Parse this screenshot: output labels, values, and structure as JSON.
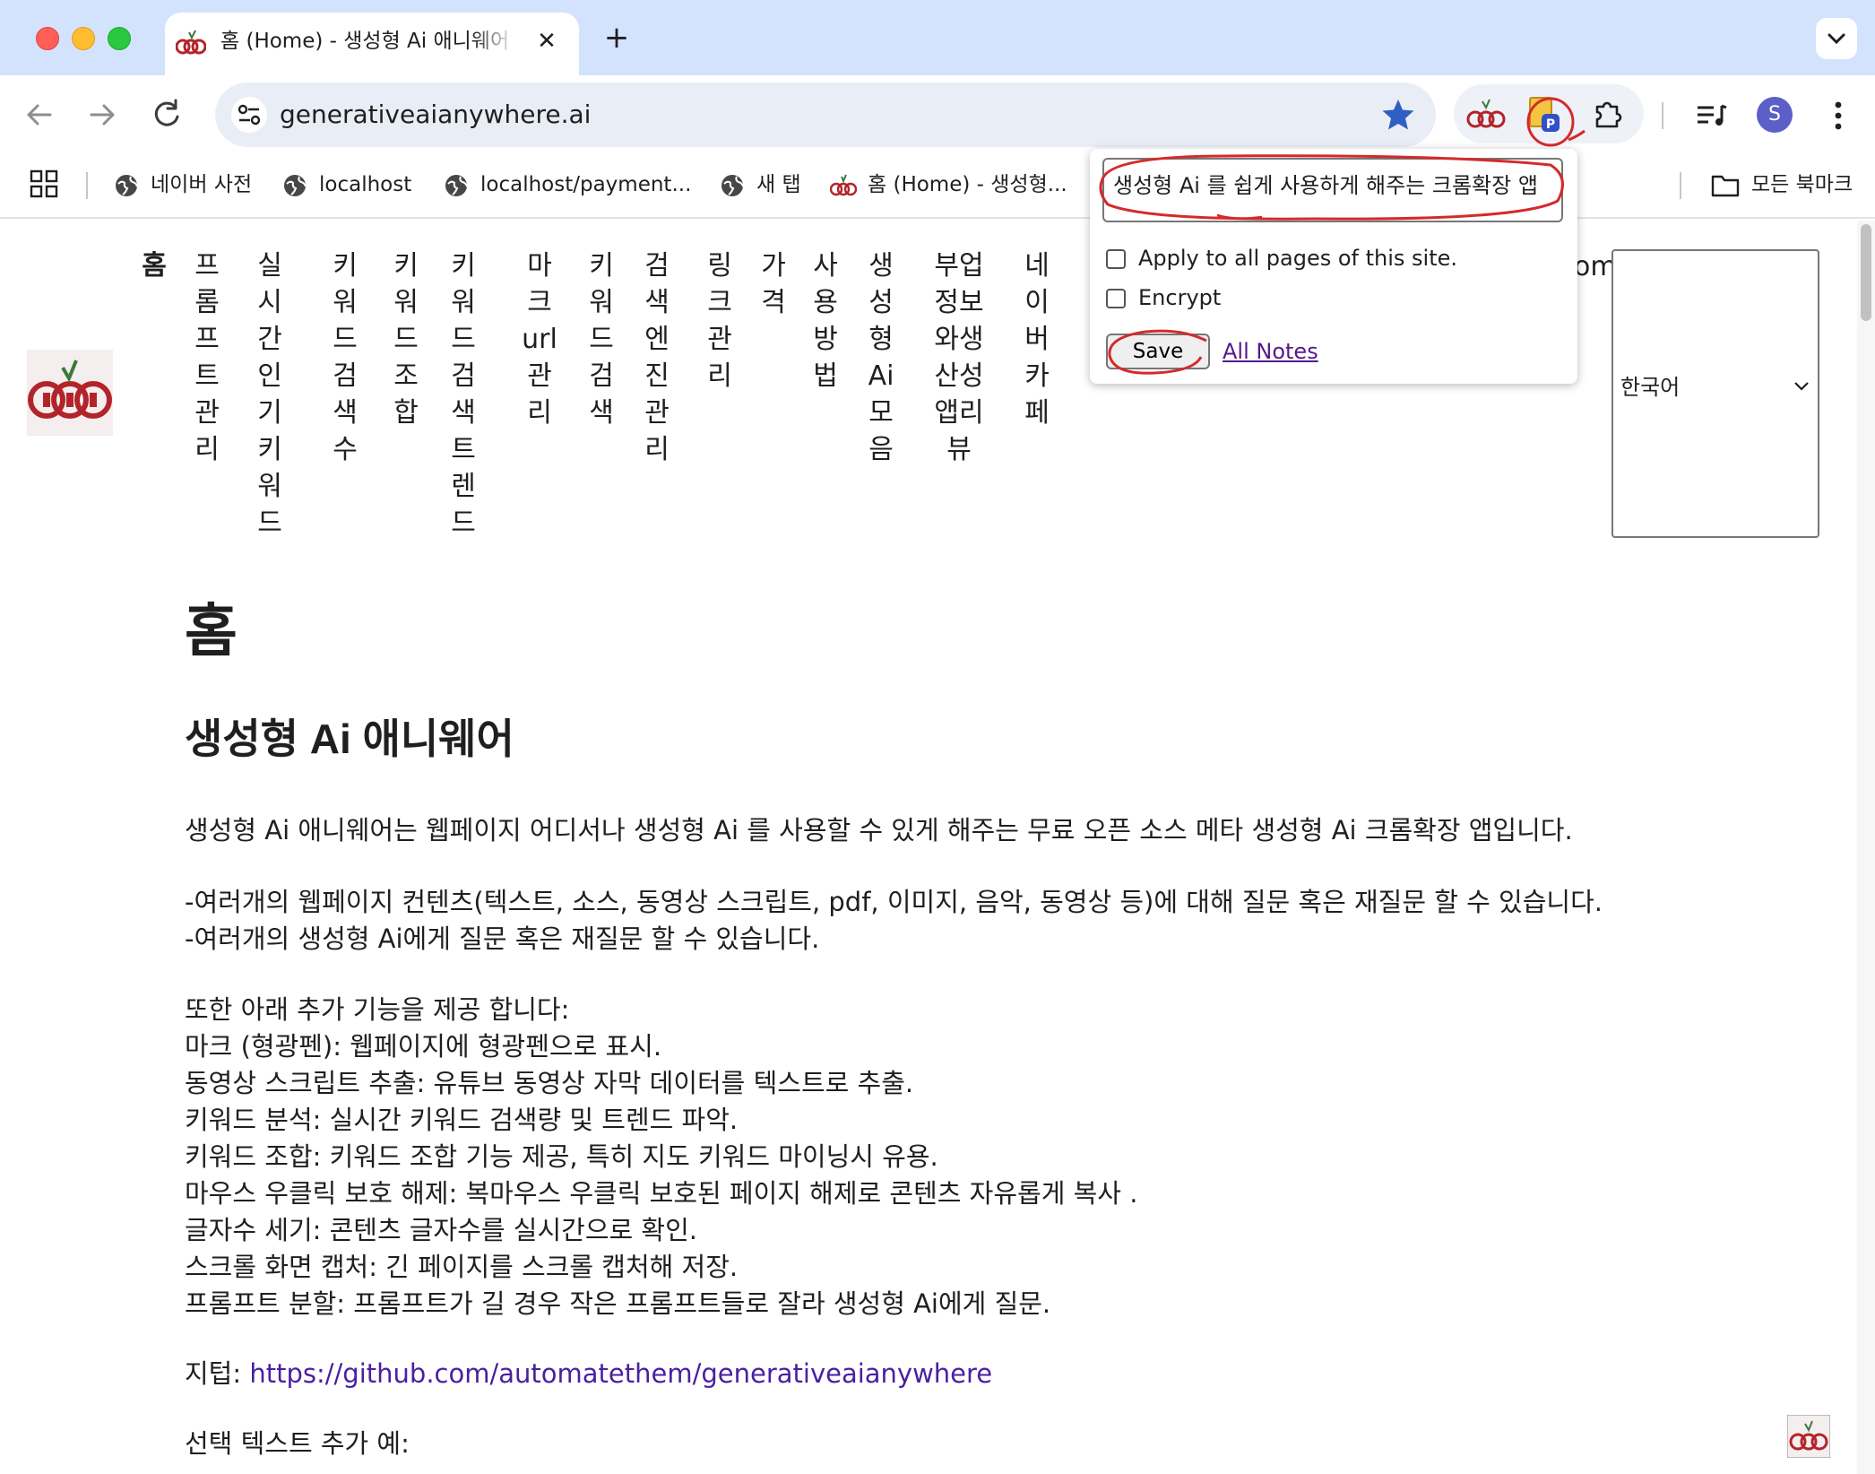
{
  "browser": {
    "tab": {
      "title": "홈 (Home) - 생성형 Ai 애니웨어 (",
      "close_icon": "close-icon"
    },
    "new_tab_label": "+",
    "url": "generativeaianywhere.ai",
    "profile_initial": "S",
    "bookmarks": [
      {
        "label": "네이버 사전"
      },
      {
        "label": "localhost"
      },
      {
        "label": "localhost/payment..."
      },
      {
        "label": "새 탭"
      },
      {
        "label": "홈 (Home) - 생성형..."
      }
    ],
    "all_bookmarks": "모든 북마크"
  },
  "site": {
    "nav": [
      {
        "label": "홈"
      },
      {
        "label": "프롬프트관리"
      },
      {
        "label": "실시간인기키워드"
      },
      {
        "label": "키워드검색수"
      },
      {
        "label": "키워드조합"
      },
      {
        "label": "키워드검색트렌드"
      },
      {
        "label": "마크url관리"
      },
      {
        "label": "키워드검색"
      },
      {
        "label": "검색엔진관리"
      },
      {
        "label": "링크관리"
      },
      {
        "label": "가격"
      },
      {
        "label": "사용방법"
      },
      {
        "label": "생성형Ai모음"
      },
      {
        "label": "부업정보와생산성앱리뷰"
      },
      {
        "label": "네이버카페"
      }
    ],
    "nav_partial": "om",
    "language": "한국어",
    "heading": "홈",
    "subheading": "생성형 Ai 애니웨어",
    "intro": "생성형 Ai 애니웨어는 웹페이지 어디서나 생성형 Ai 를 사용할 수 있게 해주는 무료 오픈 소스 메타 생성형 Ai 크롬확장 앱입니다.",
    "bullets": [
      "-여러개의 웹페이지 컨텐츠(텍스트, 소스, 동영상 스크립트, pdf, 이미지, 음악, 동영상 등)에 대해 질문 혹은 재질문 할 수 있습니다.",
      "-여러개의 생성형 Ai에게 질문 혹은 재질문 할 수 있습니다."
    ],
    "features_intro": "또한 아래 추가 기능을 제공 합니다:",
    "features": [
      "마크 (형광펜): 웹페이지에 형광펜으로 표시.",
      "동영상 스크립트 추출: 유튜브 동영상 자막 데이터를 텍스트로 추출.",
      "키워드 분석: 실시간 키워드 검색량 및 트렌드 파악.",
      "키워드 조합: 키워드 조합 기능 제공, 특히 지도 키워드 마이닝시 유용.",
      "마우스 우클릭 보호 해제: 복마우스 우클릭 보호된 페이지 해제로 콘텐츠 자유롭게 복사 .",
      "글자수 세기: 콘텐츠 글자수를 실시간으로 확인.",
      "스크롤 화면 캡처: 긴 페이지를 스크롤 캡처해 저장.",
      "프롬프트 분할: 프롬프트가 길 경우 작은 프롬프트들로 잘라 생성형 Ai에게 질문."
    ],
    "github_label": "지텁: ",
    "github_url": "https://github.com/automatethem/generativeaianywhere",
    "select_text_label": "선택 텍스트 추가 예:"
  },
  "popup": {
    "note_value": "생성형 Ai 를 쉽게 사용하게 해주는 크롬확장 앱",
    "apply_all_label": "Apply to all pages of this site.",
    "encrypt_label": "Encrypt",
    "save_label": "Save",
    "all_notes_label": "All Notes"
  },
  "colors": {
    "tabstrip": "#d3e3fd",
    "link": "#4a1fa0",
    "annotation": "#d42a2a",
    "star": "#2f5fc4"
  }
}
